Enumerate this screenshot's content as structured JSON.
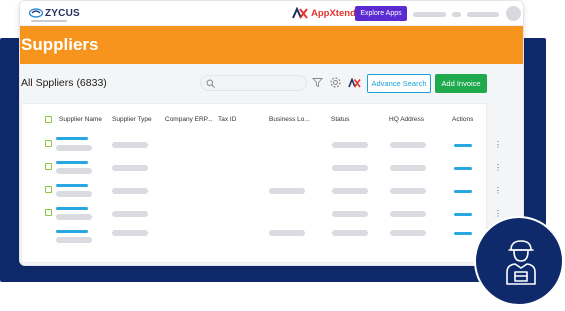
{
  "topbar": {
    "logo_text": "ZYCUS",
    "appxtend_label": "AppXtend",
    "explore_label": "Explore Apps"
  },
  "banner": {
    "title": "Suppliers"
  },
  "list": {
    "title": "All Sppliers (6833)",
    "search_placeholder": "",
    "advanced_search_label": "Advance Search",
    "add_invoice_label": "Add Invoice"
  },
  "table": {
    "columns": [
      "Supplier Name",
      "Supplier Type",
      "Company ERP...",
      "Tax ID",
      "Business Lo...",
      "Status",
      "HQ Address",
      "Actions"
    ]
  },
  "colors": {
    "banner": "#f7941d",
    "navy": "#0f2a6b",
    "explore": "#5a2bd1",
    "add_invoice": "#1eaa4d",
    "advanced_search": "#1aa0d8",
    "appxtend": "#e1352f"
  },
  "icons": [
    "zycus-logo-icon",
    "appxtend-icon",
    "search-icon",
    "filter-icon",
    "gear-icon",
    "appxtend-small-icon",
    "kebab-menu-icon",
    "worker-icon"
  ]
}
